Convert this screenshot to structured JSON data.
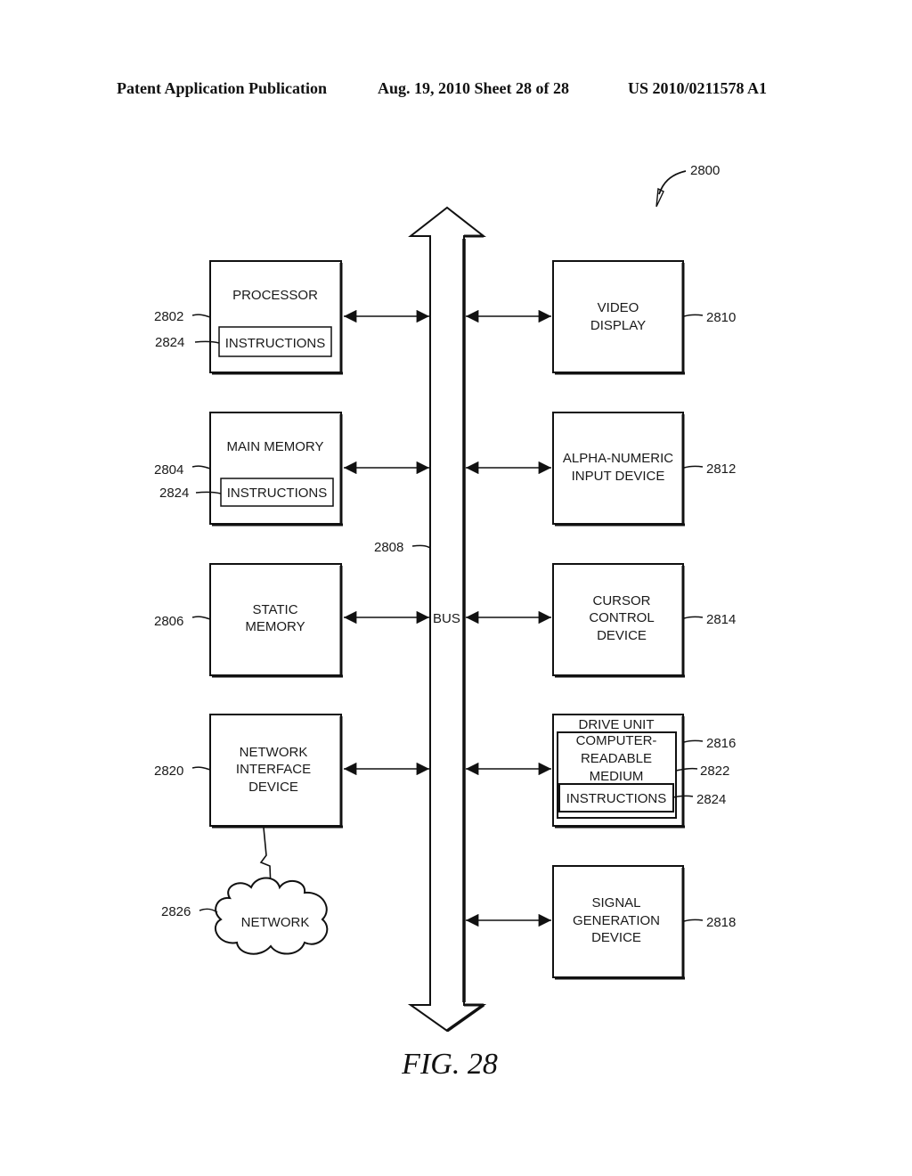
{
  "header": {
    "publication": "Patent Application Publication",
    "date_sheet": "Aug. 19, 2010  Sheet 28 of 28",
    "number": "US 2010/0211578 A1"
  },
  "figure": {
    "ref": "2800",
    "caption": "FIG. 28",
    "bus": {
      "label": "BUS",
      "ref": "2808"
    },
    "left_blocks": [
      {
        "ref": "2802",
        "lines": [
          "PROCESSOR"
        ],
        "inner": {
          "label": "INSTRUCTIONS",
          "ref": "2824"
        }
      },
      {
        "ref": "2804",
        "lines": [
          "MAIN MEMORY"
        ],
        "inner": {
          "label": "INSTRUCTIONS",
          "ref": "2824"
        }
      },
      {
        "ref": "2806",
        "lines": [
          "STATIC",
          "MEMORY"
        ]
      },
      {
        "ref": "2820",
        "lines": [
          "NETWORK",
          "INTERFACE",
          "DEVICE"
        ]
      }
    ],
    "right_blocks": [
      {
        "ref": "2810",
        "lines": [
          "VIDEO",
          "DISPLAY"
        ]
      },
      {
        "ref": "2812",
        "lines": [
          "ALPHA-NUMERIC",
          "INPUT DEVICE"
        ]
      },
      {
        "ref": "2814",
        "lines": [
          "CURSOR",
          "CONTROL",
          "DEVICE"
        ]
      },
      {
        "ref": "2816",
        "title": "DRIVE UNIT",
        "medium": {
          "lines": [
            "COMPUTER-",
            "READABLE",
            "MEDIUM"
          ],
          "ref": "2822"
        },
        "inner": {
          "label": "INSTRUCTIONS",
          "ref": "2824"
        }
      },
      {
        "ref": "2818",
        "lines": [
          "SIGNAL",
          "GENERATION",
          "DEVICE"
        ]
      }
    ],
    "network": {
      "label": "NETWORK",
      "ref": "2826"
    }
  }
}
